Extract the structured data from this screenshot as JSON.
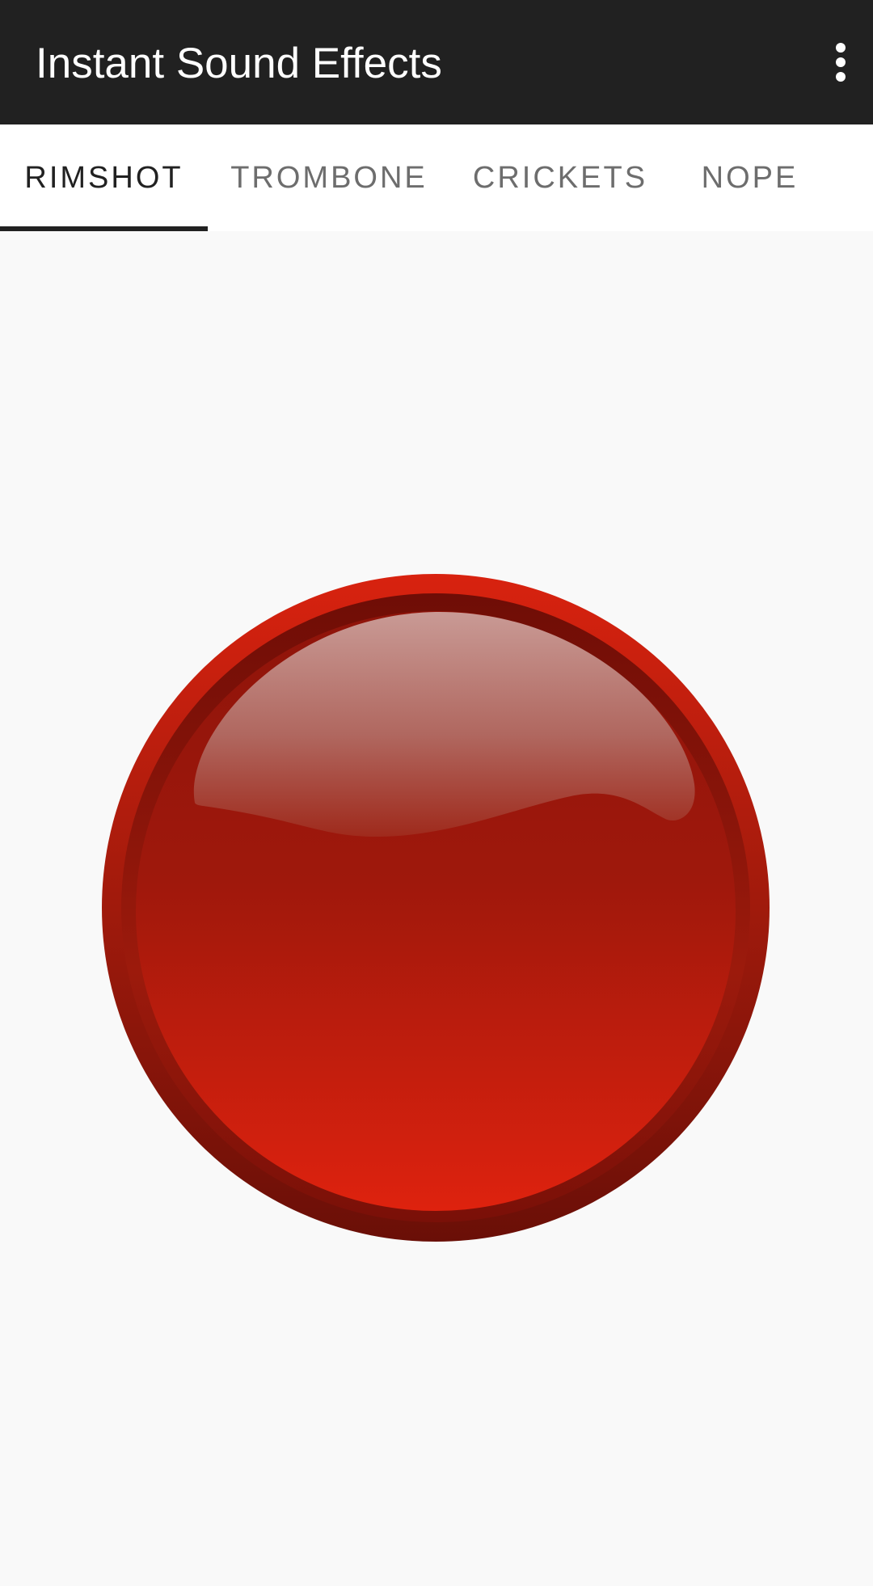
{
  "appbar": {
    "title": "Instant Sound Effects",
    "overflow_icon": "more-vert-icon",
    "background_color": "#212121"
  },
  "tabs": [
    {
      "label": "RIMSHOT",
      "active": true
    },
    {
      "label": "TROMBONE",
      "active": false
    },
    {
      "label": "CRICKETS",
      "active": false
    },
    {
      "label": "NOPE",
      "active": false
    }
  ],
  "sound_button": {
    "icon": "red-glossy-button-icon",
    "color": "#d01f10"
  }
}
